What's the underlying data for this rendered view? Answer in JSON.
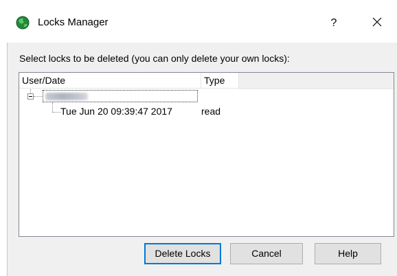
{
  "window": {
    "title": "Locks Manager",
    "help_label": "?",
    "close_icon": "close-icon",
    "app_icon": "globe-icon"
  },
  "instruction": "Select locks to be deleted (you can only delete your own locks):",
  "tree": {
    "columns": [
      "User/Date",
      "Type"
    ],
    "nodes": [
      {
        "user": "",
        "expanded": true,
        "children": [
          {
            "date": "Tue Jun 20 09:39:47 2017",
            "type": "read"
          }
        ]
      }
    ]
  },
  "buttons": {
    "delete": "Delete Locks",
    "cancel": "Cancel",
    "help": "Help"
  },
  "colors": {
    "dialog_bg": "#f0f0f0",
    "default_button_border": "#0078d7",
    "button_bg": "#e1e1e1"
  }
}
